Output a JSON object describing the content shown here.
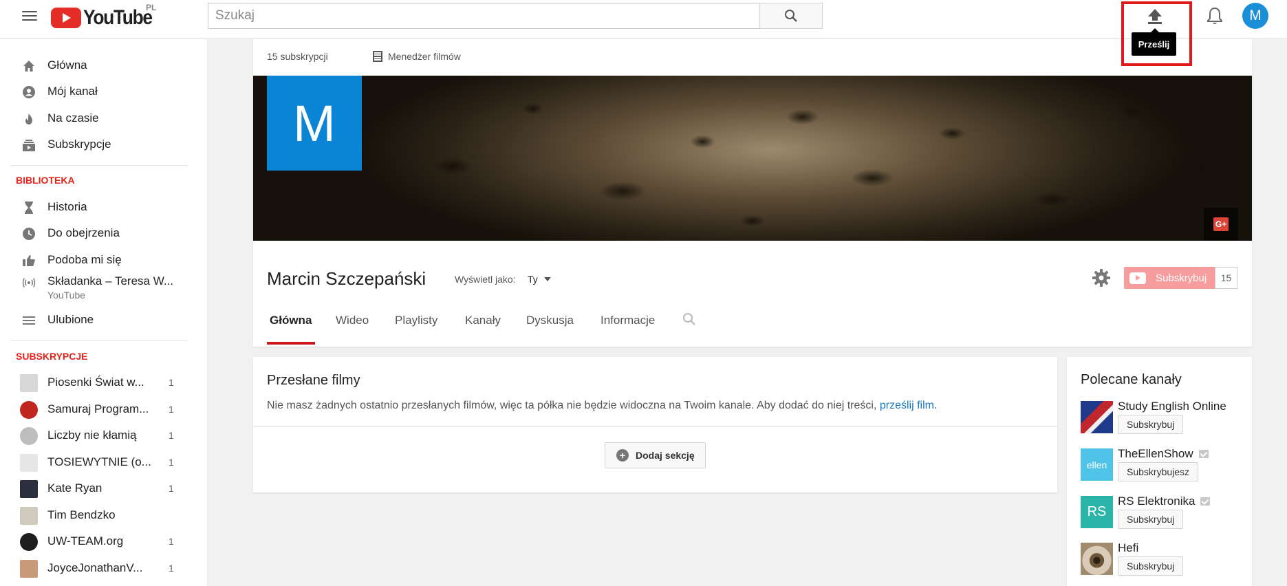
{
  "header": {
    "logo_text": "YouTube",
    "country": "PL",
    "search_placeholder": "Szukaj",
    "upload_tooltip": "Prześlij",
    "avatar_letter": "M",
    "accent_color": "#e52d27"
  },
  "sidebar": {
    "main": [
      {
        "label": "Główna",
        "icon": "home-icon"
      },
      {
        "label": "Mój kanał",
        "icon": "account-icon"
      },
      {
        "label": "Na czasie",
        "icon": "flame-icon"
      },
      {
        "label": "Subskrypcje",
        "icon": "subscriptions-icon"
      }
    ],
    "library_title": "BIBLIOTEKA",
    "library": [
      {
        "label": "Historia",
        "icon": "hourglass-icon"
      },
      {
        "label": "Do obejrzenia",
        "icon": "clock-icon"
      },
      {
        "label": "Podoba mi się",
        "icon": "thumbs-up-icon"
      },
      {
        "label": "Składanka – Teresa W...",
        "sub": "YouTube",
        "icon": "broadcast-icon"
      },
      {
        "label": "Ulubione",
        "icon": "list-icon"
      }
    ],
    "subs_title": "SUBSKRYPCJE",
    "subscriptions": [
      {
        "label": "Piosenki Świat w...",
        "count": "1",
        "color": "#d8d8d8"
      },
      {
        "label": "Samuraj Program...",
        "count": "1",
        "color": "#c0261f"
      },
      {
        "label": "Liczby nie kłamią",
        "count": "1",
        "color": "#bdbdbd"
      },
      {
        "label": "TOSIEWYTNIE (o...",
        "count": "1",
        "color": "#e6e6e6"
      },
      {
        "label": "Kate Ryan",
        "count": "1",
        "color": "#2b2f3e"
      },
      {
        "label": "Tim Bendzko",
        "count": "",
        "color": "#cfc9be"
      },
      {
        "label": "UW-TEAM.org",
        "count": "1",
        "color": "#1e1e1e"
      },
      {
        "label": "JoyceJonathanV...",
        "count": "1",
        "color": "#c89a7a"
      }
    ]
  },
  "channel": {
    "subs_link": "15 subskrypcji",
    "manager_link": "Menedżer filmów",
    "avatar_letter": "M",
    "avatar_color": "#0a84d4",
    "gplus_label": "G+",
    "name": "Marcin Szczepański",
    "view_as_label": "Wyświetl jako:",
    "view_as_value": "Ty",
    "subscribe_label": "Subskrybuj",
    "subscriber_count": "15",
    "tabs": [
      "Główna",
      "Wideo",
      "Playlisty",
      "Kanały",
      "Dyskusja",
      "Informacje"
    ]
  },
  "uploads": {
    "title": "Przesłane filmy",
    "message": "Nie masz żadnych ostatnio przesłanych filmów, więc ta półka nie będzie widoczna na Twoim kanale. Aby dodać do niej treści, ",
    "link": "prześlij film",
    "message_end": ".",
    "add_section": "Dodaj sekcję"
  },
  "recommended": {
    "title": "Polecane kanały",
    "items": [
      {
        "name": "Study English Online",
        "button": "Subskrybuj",
        "verified": false
      },
      {
        "name": "TheEllenShow",
        "button": "Subskrybujesz",
        "verified": true
      },
      {
        "name": "RS Elektronika",
        "button": "Subskrybuj",
        "verified": true
      },
      {
        "name": "Hefi",
        "button": "Subskrybuj",
        "verified": false
      }
    ]
  }
}
